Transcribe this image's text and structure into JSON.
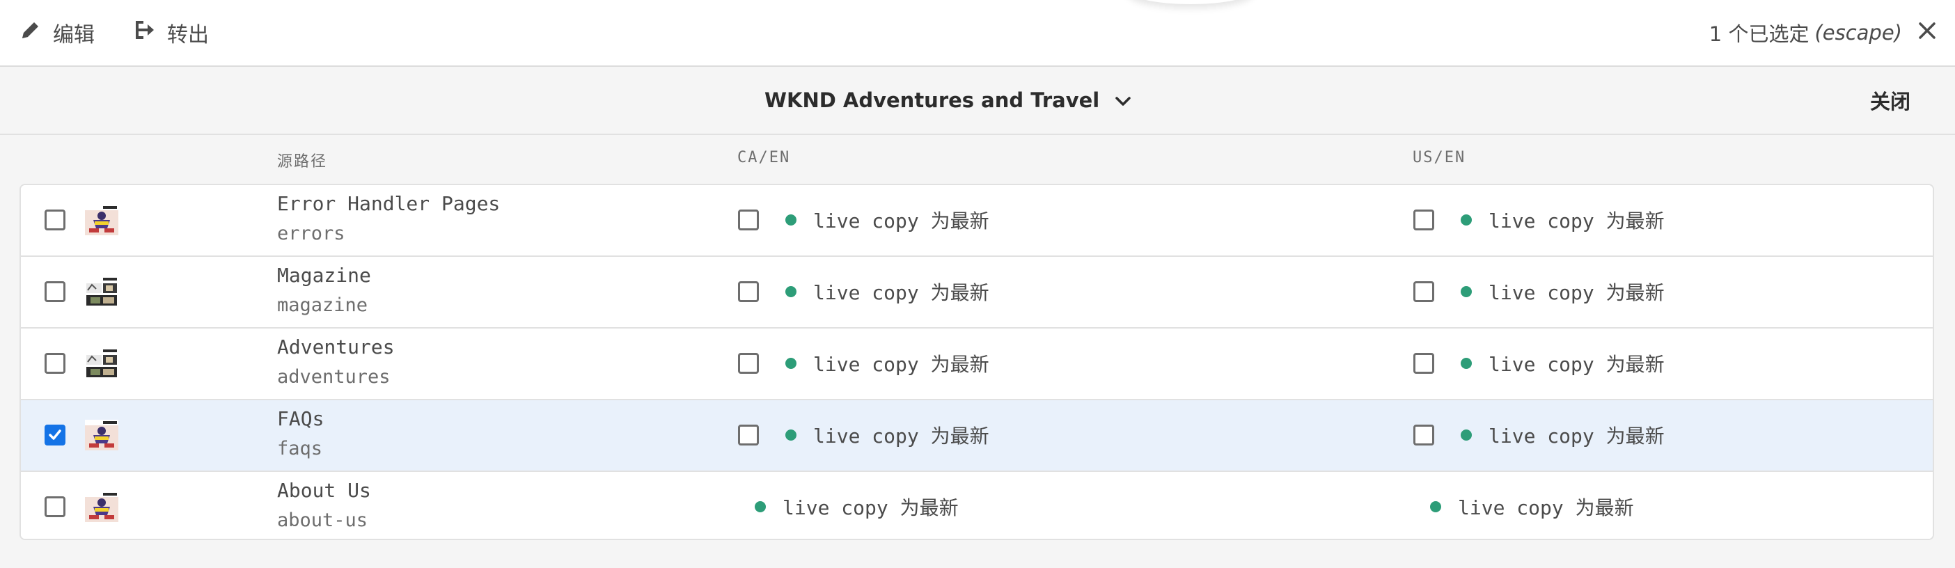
{
  "toolbar": {
    "edit_label": "编辑",
    "export_label": "转出",
    "selection_count": "1 个已选定",
    "selection_hint": "(escape)",
    "edit_icon": "pencil-icon",
    "export_icon": "export-icon",
    "close_icon": "close-icon"
  },
  "header": {
    "site_title": "WKND Adventures and Travel",
    "site_chevron_icon": "chevron-down-icon",
    "close_label": "关闭"
  },
  "columns": {
    "source": "源路径",
    "ca": "CA/EN",
    "us": "US/EN"
  },
  "colors": {
    "status_ok": "#2d9d78",
    "accent": "#1473e6",
    "selected_row": "#e9f1fb"
  },
  "rows": [
    {
      "title": "Error Handler Pages",
      "path": "errors",
      "selected": false,
      "thumbnail": "page-thumbnail-icon",
      "ca": {
        "status": "live copy 为最新",
        "has_checkbox": true,
        "checked": false
      },
      "us": {
        "status": "live copy 为最新",
        "has_checkbox": true,
        "checked": false
      }
    },
    {
      "title": "Magazine",
      "path": "magazine",
      "selected": false,
      "thumbnail": "page-thumbnail-icon",
      "ca": {
        "status": "live copy 为最新",
        "has_checkbox": true,
        "checked": false
      },
      "us": {
        "status": "live copy 为最新",
        "has_checkbox": true,
        "checked": false
      }
    },
    {
      "title": "Adventures",
      "path": "adventures",
      "selected": false,
      "thumbnail": "page-thumbnail-icon",
      "ca": {
        "status": "live copy 为最新",
        "has_checkbox": true,
        "checked": false
      },
      "us": {
        "status": "live copy 为最新",
        "has_checkbox": true,
        "checked": false
      }
    },
    {
      "title": "FAQs",
      "path": "faqs",
      "selected": true,
      "thumbnail": "page-thumbnail-icon",
      "ca": {
        "status": "live copy 为最新",
        "has_checkbox": true,
        "checked": false
      },
      "us": {
        "status": "live copy 为最新",
        "has_checkbox": true,
        "checked": false
      }
    },
    {
      "title": "About Us",
      "path": "about-us",
      "selected": false,
      "thumbnail": "page-thumbnail-icon",
      "ca": {
        "status": "live copy 为最新",
        "has_checkbox": false,
        "checked": false
      },
      "us": {
        "status": "live copy 为最新",
        "has_checkbox": false,
        "checked": false
      }
    }
  ]
}
